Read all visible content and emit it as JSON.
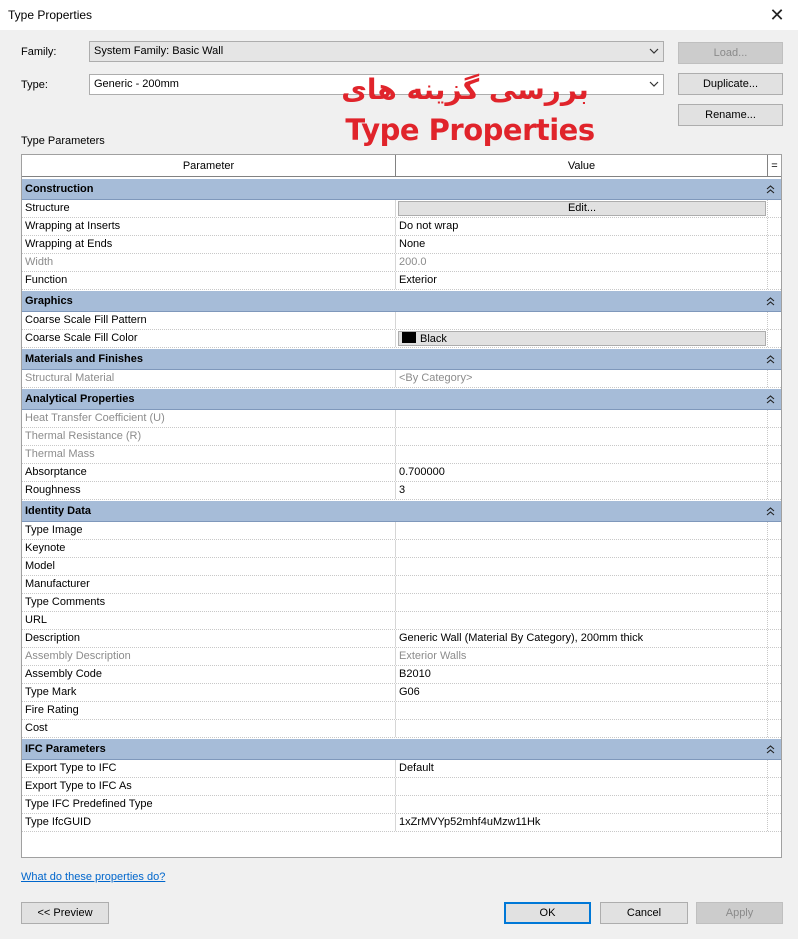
{
  "window": {
    "title": "Type Properties"
  },
  "family": {
    "label": "Family:",
    "value": "System Family: Basic Wall"
  },
  "type": {
    "label": "Type:",
    "value": "Generic - 200mm"
  },
  "buttons": {
    "load": "Load...",
    "duplicate": "Duplicate...",
    "rename": "Rename..."
  },
  "overlay": {
    "line1": "بررسی گزینه های",
    "line2": "Type Properties"
  },
  "type_parameters": {
    "label": "Type Parameters"
  },
  "grid": {
    "columns": {
      "parameter": "Parameter",
      "value": "Value",
      "toggle": "="
    },
    "groups": [
      {
        "name": "Construction",
        "rows": [
          {
            "param": "Structure",
            "value": "Edit...",
            "kind": "button",
            "readonly": false
          },
          {
            "param": "Wrapping at Inserts",
            "value": "Do not wrap",
            "readonly": false
          },
          {
            "param": "Wrapping at Ends",
            "value": "None",
            "readonly": false
          },
          {
            "param": "Width",
            "value": "200.0",
            "readonly": true
          },
          {
            "param": "Function",
            "value": "Exterior",
            "readonly": false
          }
        ]
      },
      {
        "name": "Graphics",
        "rows": [
          {
            "param": "Coarse Scale Fill Pattern",
            "value": "",
            "readonly": false
          },
          {
            "param": "Coarse Scale Fill Color",
            "value": "Black",
            "kind": "color",
            "color": "#000000",
            "readonly": false
          }
        ]
      },
      {
        "name": "Materials and Finishes",
        "rows": [
          {
            "param": "Structural Material",
            "value": "<By Category>",
            "readonly": true
          }
        ]
      },
      {
        "name": "Analytical Properties",
        "rows": [
          {
            "param": "Heat Transfer Coefficient (U)",
            "value": "",
            "readonly": true
          },
          {
            "param": "Thermal Resistance (R)",
            "value": "",
            "readonly": true
          },
          {
            "param": "Thermal Mass",
            "value": "",
            "readonly": true
          },
          {
            "param": "Absorptance",
            "value": "0.700000",
            "readonly": false
          },
          {
            "param": "Roughness",
            "value": "3",
            "readonly": false
          }
        ]
      },
      {
        "name": "Identity Data",
        "rows": [
          {
            "param": "Type Image",
            "value": "",
            "readonly": false
          },
          {
            "param": "Keynote",
            "value": "",
            "readonly": false
          },
          {
            "param": "Model",
            "value": "",
            "readonly": false
          },
          {
            "param": "Manufacturer",
            "value": "",
            "readonly": false
          },
          {
            "param": "Type Comments",
            "value": "",
            "readonly": false
          },
          {
            "param": "URL",
            "value": "",
            "readonly": false
          },
          {
            "param": "Description",
            "value": "Generic Wall (Material By Category), 200mm thick",
            "readonly": false
          },
          {
            "param": "Assembly Description",
            "value": "Exterior Walls",
            "readonly": true
          },
          {
            "param": "Assembly Code",
            "value": "B2010",
            "readonly": false
          },
          {
            "param": "Type Mark",
            "value": "G06",
            "readonly": false
          },
          {
            "param": "Fire Rating",
            "value": "",
            "readonly": false
          },
          {
            "param": "Cost",
            "value": "",
            "readonly": false
          }
        ]
      },
      {
        "name": "IFC Parameters",
        "rows": [
          {
            "param": "Export Type to IFC",
            "value": "Default",
            "readonly": false
          },
          {
            "param": "Export Type to IFC As",
            "value": "",
            "readonly": false
          },
          {
            "param": "Type IFC Predefined Type",
            "value": "",
            "readonly": false
          },
          {
            "param": "Type IfcGUID",
            "value": "1xZrMVYp52mhf4uMzw11Hk",
            "readonly": false
          }
        ]
      }
    ]
  },
  "help_link": "What do these properties do?",
  "footer": {
    "preview": "<< Preview",
    "ok": "OK",
    "cancel": "Cancel",
    "apply": "Apply"
  }
}
